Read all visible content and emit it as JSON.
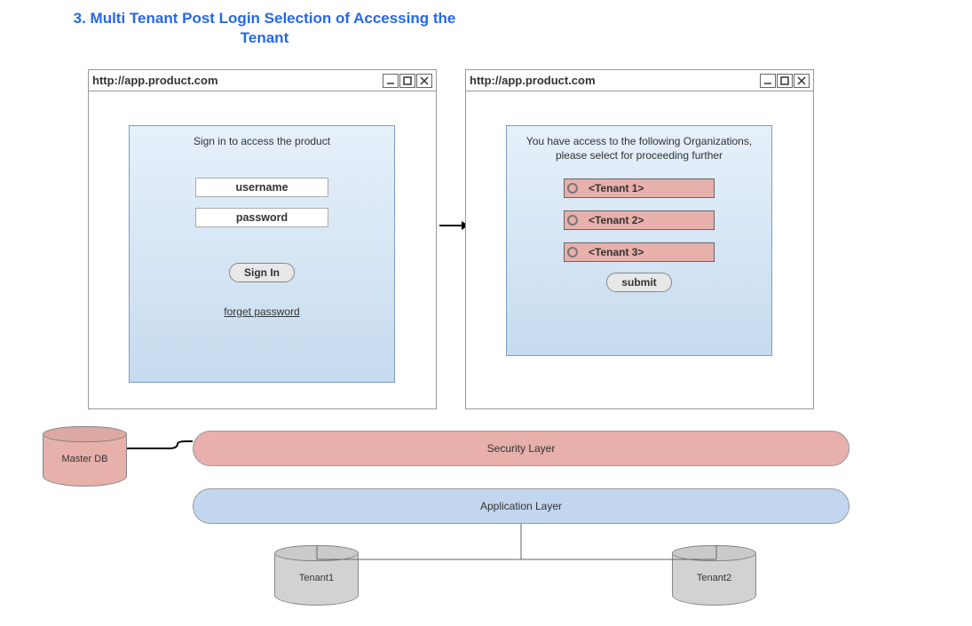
{
  "heading": "3. Multi Tenant Post Login Selection of Accessing the Tenant",
  "browser1": {
    "url": "http://app.product.com",
    "panel_title": "Sign in to access the product",
    "username_placeholder": "username",
    "password_placeholder": "password",
    "signin_label": "Sign In",
    "forget_label": "forget password"
  },
  "browser2": {
    "url": "http://app.product.com",
    "panel_title": "You have access to the following Organizations, please select for proceeding further",
    "tenants": [
      {
        "label": "<Tenant 1>"
      },
      {
        "label": "<Tenant 2>"
      },
      {
        "label": "<Tenant 3>"
      }
    ],
    "submit_label": "submit"
  },
  "layers": {
    "security": "Security Layer",
    "application": "Application Layer"
  },
  "databases": {
    "master": "Master DB",
    "tenant1": "Tenant1",
    "tenant2": "Tenant2"
  }
}
